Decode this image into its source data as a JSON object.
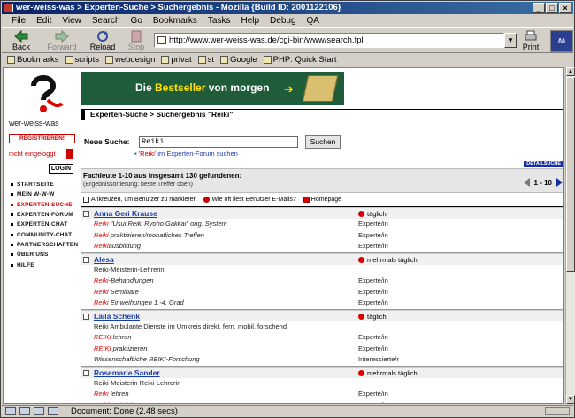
{
  "window": {
    "title": "wer-weiss-was > Experten-Suche > Suchergebnis - Mozilla {Build ID: 2001122106}"
  },
  "menu": [
    {
      "label": "File"
    },
    {
      "label": "Edit"
    },
    {
      "label": "View"
    },
    {
      "label": "Search"
    },
    {
      "label": "Go"
    },
    {
      "label": "Bookmarks"
    },
    {
      "label": "Tasks"
    },
    {
      "label": "Help"
    },
    {
      "label": "Debug"
    },
    {
      "label": "QA"
    }
  ],
  "nav": {
    "back": "Back",
    "forward": "Forward",
    "reload": "Reload",
    "stop": "Stop",
    "url": "http://www.wer-weiss-was.de/cgi-bin/www/search.fpl",
    "print": "Print"
  },
  "bookmarks": [
    {
      "label": "Bookmarks"
    },
    {
      "label": "scripts"
    },
    {
      "label": "webdesign"
    },
    {
      "label": "privat"
    },
    {
      "label": "st"
    },
    {
      "label": "Google"
    },
    {
      "label": "PHP: Quick Start"
    }
  ],
  "status": {
    "text": "Document: Done (2.48 secs)"
  },
  "site": {
    "brand": "wer-weiss-was",
    "register": "REGISTRIEREN!",
    "login_state": "nicht eingeloggt",
    "login": "LOGIN",
    "nav": [
      {
        "label": "STARTSEITE"
      },
      {
        "label": "MEIN W-W-W"
      },
      {
        "label": "EXPERTEN-SUCHE"
      },
      {
        "label": "EXPERTEN-FORUM"
      },
      {
        "label": "EXPERTEN-CHAT"
      },
      {
        "label": "COMMUNITY-CHAT"
      },
      {
        "label": "PARTNERSCHAFTEN"
      },
      {
        "label": "ÜBER UNS"
      },
      {
        "label": "HILFE"
      }
    ],
    "banner_a": "Die ",
    "banner_b": "Bestseller",
    " banner_c": "",
    "banner_c2": " von morgen",
    "breadcrumb": "Experten-Suche > Suchergebnis \"Reiki\"",
    "search_label": "Neue Suche:",
    "search_value": "Reiki",
    "search_button": "Suchen",
    "forum_link_a": "'Reiki'",
    "forum_link_b": " im Experten-Forum suchen",
    "detail": "DETAILSUCHE",
    "result_count": "Fachleute 1-10 aus insgesamt 130 gefundenen:",
    "result_sort": "(Ergebnissortierung: beste Treffer oben)",
    "pager": "1 - 10",
    "legend": {
      "check": "Ankreuzen, um Benutzer zu markieren",
      "email": "Wie oft liest Benutzer E-Mails?",
      "homepage": "Homepage"
    },
    "entries": [
      {
        "name": "Anna Geri Krause",
        "freq": "täglich",
        "rows": [
          {
            "hl": "Reiki",
            "rest": " \"Usui Reiki Ryoho Gakkai\" orig. System",
            "level": "Experte/in",
            "italic": true
          },
          {
            "hl": "Reiki",
            "rest": " praktizieren/monatliches Treffen",
            "level": "Experte/in",
            "italic": true
          },
          {
            "hl": "Reiki",
            "rest": "ausbildung",
            "level": "Experte/in",
            "italic": true
          }
        ]
      },
      {
        "name": "Alesa",
        "freq": "mehrmals täglich",
        "rows": [
          {
            "hl": "",
            "rest": "Reiki-Meisterin-Lehrerin",
            "level": "",
            "italic": false
          },
          {
            "hl": "Reiki",
            "rest": "-Behandlungen",
            "level": "Experte/in",
            "italic": true
          },
          {
            "hl": "Reiki",
            "rest": " Seminare",
            "level": "Experte/in",
            "italic": true
          },
          {
            "hl": "Reiki",
            "rest": " Einweihungen 1.-4. Grad",
            "level": "Experte/in",
            "italic": true
          }
        ]
      },
      {
        "name": "Laila Schenk",
        "freq": "täglich",
        "rows": [
          {
            "hl": "",
            "rest": "Reiki Ambulante Dienste im Umkreis  direkt, fern, mobil, forschend",
            "level": "",
            "italic": false
          },
          {
            "hl": "REIKI",
            "rest": " lehren",
            "level": "Experte/in",
            "italic": true
          },
          {
            "hl": "REIKI",
            "rest": " praktizieren",
            "level": "Experte/in",
            "italic": true
          },
          {
            "hl": "",
            "rest": "Wissenschaftliche REIKI-Forschung",
            "level": "Interessierte/r",
            "italic": true
          }
        ]
      },
      {
        "name": "Rosemarie Sander",
        "freq": "mehrmals täglich",
        "rows": [
          {
            "hl": "",
            "rest": "Reiki-Meisterin  Reiki-Lehrerin",
            "level": "",
            "italic": false
          },
          {
            "hl": "Reiki",
            "rest": " lehren",
            "level": "Experte/in",
            "italic": true
          },
          {
            "hl": "Reiki",
            "rest": " praktizieren",
            "level": "Experte/in",
            "italic": true
          }
        ]
      }
    ]
  },
  "colors": {
    "accent": "#1a2f9f",
    "highlight": "#d00000",
    "banner": "#1f5c3a"
  }
}
